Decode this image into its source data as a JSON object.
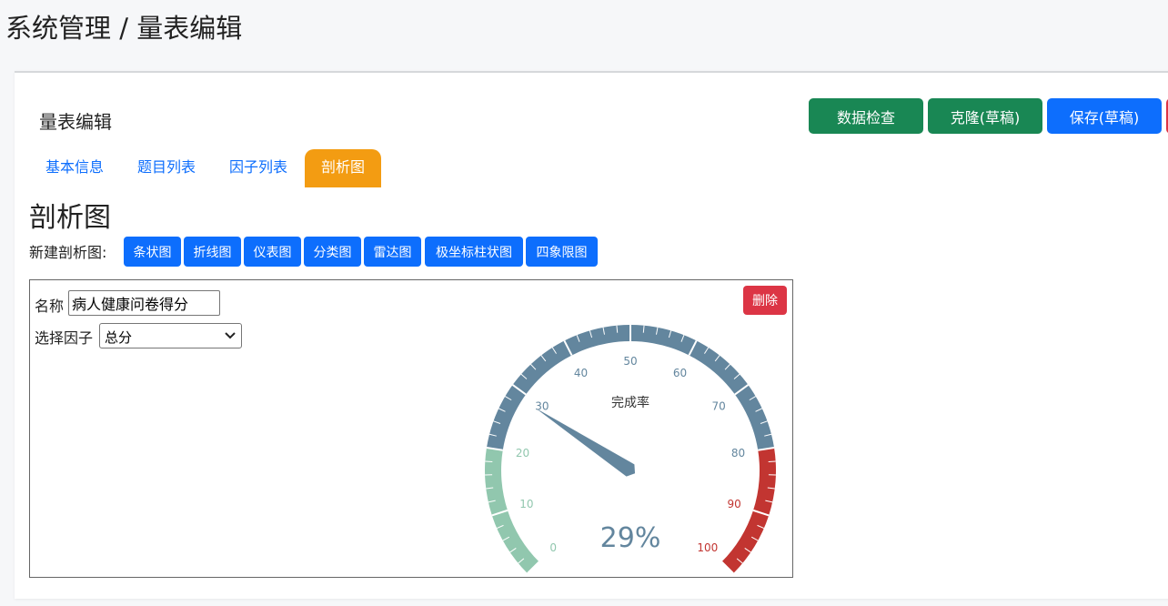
{
  "breadcrumb": {
    "text": "系统管理 / 量表编辑"
  },
  "card": {
    "title": "量表编辑"
  },
  "toolbar": {
    "check_label": "数据检查",
    "clone_label": "克隆(草稿)",
    "save_label": "保存(草稿)",
    "button_colors": {
      "green": "#198754",
      "blue": "#0d6efd",
      "red": "#dc3545"
    }
  },
  "tabs": [
    {
      "label": "基本信息",
      "active": false
    },
    {
      "label": "题目列表",
      "active": false
    },
    {
      "label": "因子列表",
      "active": false
    },
    {
      "label": "剖析图",
      "active": true
    }
  ],
  "tab_active_color": "#f39c12",
  "section": {
    "title": "剖析图",
    "new_label": "新建剖析图:"
  },
  "chart_buttons": [
    "条状图",
    "折线图",
    "仪表图",
    "分类图",
    "雷达图",
    "极坐标柱状图",
    "四象限图"
  ],
  "panel": {
    "name_label": "名称",
    "name_value": "病人健康问卷得分",
    "factor_label": "选择因子",
    "factor_value": "总分",
    "delete_label": "删除"
  },
  "chart_data": {
    "type": "gauge",
    "title": "完成率",
    "value": 29,
    "value_label": "29%",
    "min": 0,
    "max": 100,
    "tick_labels": [
      "0",
      "10",
      "20",
      "30",
      "40",
      "50",
      "60",
      "70",
      "80",
      "90",
      "100"
    ],
    "bands": [
      {
        "from": 0,
        "to": 20,
        "color": "#91c7ae"
      },
      {
        "from": 20,
        "to": 80,
        "color": "#63869e"
      },
      {
        "from": 80,
        "to": 100,
        "color": "#c23531"
      }
    ],
    "pointer_color": "#63869e"
  }
}
